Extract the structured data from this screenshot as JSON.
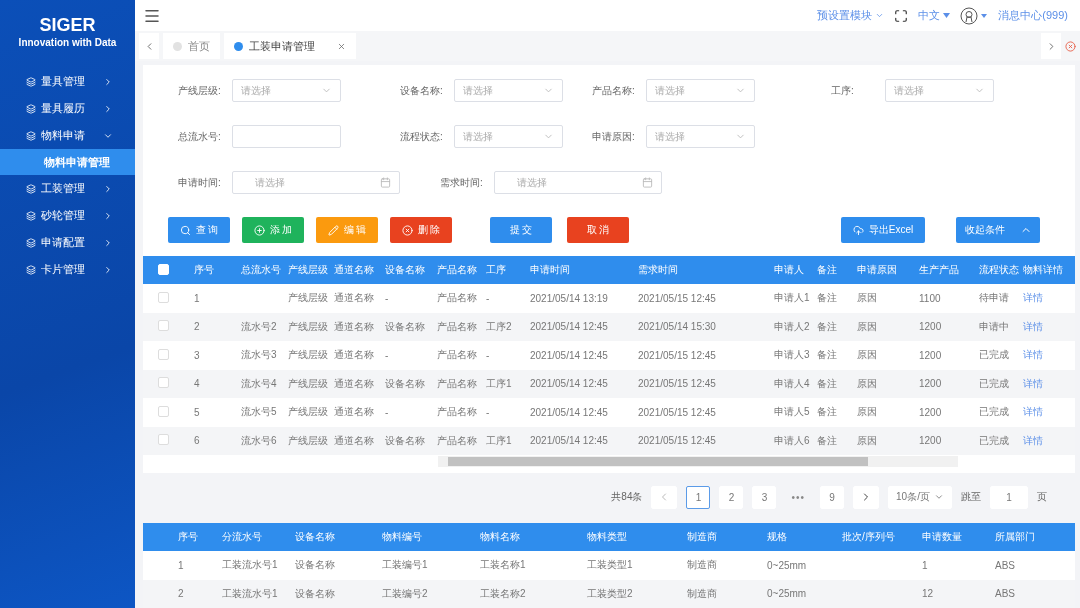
{
  "sidebar": {
    "logo": "SIGER",
    "tagline": "Innovation with Data",
    "items": [
      {
        "label": "量具管理",
        "expanded": false
      },
      {
        "label": "量具履历",
        "expanded": false
      },
      {
        "label": "物料申请",
        "expanded": true,
        "children": [
          {
            "label": "物料申请管理",
            "selected": true
          }
        ]
      },
      {
        "label": "工装管理",
        "expanded": false
      },
      {
        "label": "砂轮管理",
        "expanded": false
      },
      {
        "label": "申请配置",
        "expanded": false
      },
      {
        "label": "卡片管理",
        "expanded": false
      }
    ]
  },
  "header": {
    "module": "预设置模块",
    "language": "中文",
    "messages": "消息中心(999)"
  },
  "tabs": [
    {
      "label": "首页",
      "selected": false,
      "closable": false
    },
    {
      "label": "工装申请管理",
      "selected": true,
      "closable": true
    }
  ],
  "filters": [
    [
      {
        "label": "产线层级:",
        "kind": "select",
        "placeholder": "请选择"
      },
      {
        "label": "设备名称:",
        "kind": "select",
        "placeholder": "请选择"
      },
      {
        "label": "产品名称:",
        "kind": "select",
        "placeholder": "请选择"
      },
      {
        "label": "工序:",
        "kind": "select",
        "placeholder": "请选择"
      }
    ],
    [
      {
        "label": "总流水号:",
        "kind": "input"
      },
      {
        "label": "流程状态:",
        "kind": "select",
        "placeholder": "请选择"
      },
      {
        "label": "申请原因:",
        "kind": "select",
        "placeholder": "请选择"
      }
    ],
    [
      {
        "label": "申请时间:",
        "kind": "date",
        "placeholder": "请选择"
      },
      {
        "label": "需求时间:",
        "kind": "date",
        "placeholder": "请选择"
      }
    ]
  ],
  "actions": [
    {
      "label": "查 询",
      "color": "#2f8ded",
      "kind": "search"
    },
    {
      "label": "添 加",
      "color": "#1fb35c",
      "kind": "add"
    },
    {
      "label": "编 辑",
      "color": "#fb9a0e",
      "kind": "edit"
    },
    {
      "label": "删 除",
      "color": "#e8421f",
      "kind": "delete"
    },
    {
      "label": "提 交",
      "color": "#2f8ded",
      "kind": "plain"
    },
    {
      "label": "取 消",
      "color": "#e8421f",
      "kind": "plain"
    },
    {
      "label": "导出Excel",
      "color": "#2f8ded",
      "kind": "export"
    },
    {
      "label": "收起条件",
      "color": "#2f8ded",
      "kind": "collapse"
    }
  ],
  "table": {
    "header_checked": false,
    "columns": [
      {
        "label": "序号",
        "kind": "text"
      },
      {
        "label": "总流水号",
        "kind": "text"
      },
      {
        "label": "产线层级",
        "kind": "text"
      },
      {
        "label": "通道名称",
        "kind": "text"
      },
      {
        "label": "设备名称",
        "kind": "text"
      },
      {
        "label": "产品名称",
        "kind": "text"
      },
      {
        "label": "工序",
        "kind": "text"
      },
      {
        "label": "申请时间",
        "kind": "text"
      },
      {
        "label": "需求时间",
        "kind": "text"
      },
      {
        "label": "申请人",
        "kind": "text"
      },
      {
        "label": "备注",
        "kind": "text"
      },
      {
        "label": "申请原因",
        "kind": "text"
      },
      {
        "label": "生产产品",
        "kind": "text"
      },
      {
        "label": "流程状态",
        "kind": "text"
      },
      {
        "label": "物料详情",
        "kind": "link"
      }
    ],
    "rows": [
      {
        "checked": false,
        "cells": [
          "1",
          null,
          "产线层级",
          "通道名称",
          "-",
          "产品名称",
          "-",
          "2021/05/14 13:19",
          "2021/05/15 12:45",
          "申请人1",
          "备注",
          "原因",
          "1100",
          "待申请",
          "详情"
        ]
      },
      {
        "checked": false,
        "cells": [
          "2",
          "流水号2",
          "产线层级",
          "通道名称",
          "设备名称",
          "产品名称",
          "工序2",
          "2021/05/14 12:45",
          "2021/05/14 15:30",
          "申请人2",
          "备注",
          "原因",
          "1200",
          "申请中",
          "详情"
        ]
      },
      {
        "checked": false,
        "cells": [
          "3",
          "流水号3",
          "产线层级",
          "通道名称",
          "-",
          "产品名称",
          "-",
          "2021/05/14 12:45",
          "2021/05/15 12:45",
          "申请人3",
          "备注",
          "原因",
          "1200",
          "已完成",
          "详情"
        ]
      },
      {
        "checked": false,
        "cells": [
          "4",
          "流水号4",
          "产线层级",
          "通道名称",
          "设备名称",
          "产品名称",
          "工序1",
          "2021/05/14 12:45",
          "2021/05/15 12:45",
          "申请人4",
          "备注",
          "原因",
          "1200",
          "已完成",
          "详情"
        ]
      },
      {
        "checked": false,
        "cells": [
          "5",
          "流水号5",
          "产线层级",
          "通道名称",
          "-",
          "产品名称",
          "-",
          "2021/05/14 12:45",
          "2021/05/15 12:45",
          "申请人5",
          "备注",
          "原因",
          "1200",
          "已完成",
          "详情"
        ]
      },
      {
        "checked": false,
        "cells": [
          "6",
          "流水号6",
          "产线层级",
          "通道名称",
          "设备名称",
          "产品名称",
          "工序1",
          "2021/05/14 12:45",
          "2021/05/15 12:45",
          "申请人6",
          "备注",
          "原因",
          "1200",
          "已完成",
          "详情"
        ]
      }
    ]
  },
  "pagination": {
    "total": "共84条",
    "pages": [
      {
        "label": "1",
        "kind": "page",
        "selected": true
      },
      {
        "label": "2",
        "kind": "page",
        "selected": false
      },
      {
        "label": "3",
        "kind": "page",
        "selected": false
      },
      {
        "label": "•••",
        "kind": "ellipsis"
      },
      {
        "label": "9",
        "kind": "page",
        "selected": false
      }
    ],
    "page_size": "10条/页",
    "jump_label": "跳至",
    "jump_value": "1",
    "jump_suffix": "页"
  },
  "detail_table": {
    "columns": [
      "序号",
      "分流水号",
      "设备名称",
      "物料编号",
      "物料名称",
      "物料类型",
      "制造商",
      "规格",
      "批次/序列号",
      "申请数量",
      "所属部门"
    ],
    "rows": [
      [
        "1",
        "工装流水号1",
        "设备名称",
        "工装编号1",
        "工装名称1",
        "工装类型1",
        "制造商",
        "0~25mm",
        null,
        "1",
        "ABS"
      ],
      [
        "2",
        "工装流水号1",
        "设备名称",
        "工装编号2",
        "工装名称2",
        "工装类型2",
        "制造商",
        "0~25mm",
        null,
        "12",
        "ABS"
      ]
    ]
  }
}
